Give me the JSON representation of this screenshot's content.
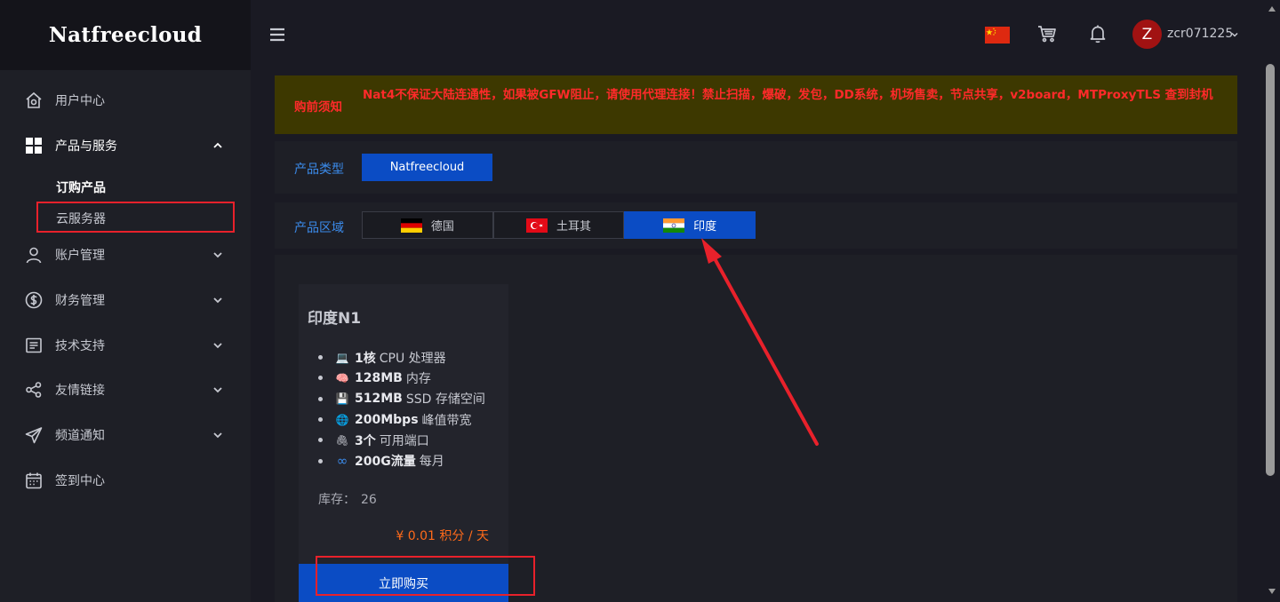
{
  "brand": {
    "name": "Natfreecloud"
  },
  "sidebar": {
    "items": [
      {
        "label": "用户中心",
        "icon": "home-icon"
      },
      {
        "label": "产品与服务",
        "icon": "grid-icon"
      },
      {
        "label": "账户管理",
        "icon": "user-icon"
      },
      {
        "label": "财务管理",
        "icon": "dollar-icon"
      },
      {
        "label": "技术支持",
        "icon": "document-icon"
      },
      {
        "label": "友情链接",
        "icon": "share-icon"
      },
      {
        "label": "频道通知",
        "icon": "send-icon"
      },
      {
        "label": "签到中心",
        "icon": "calendar-icon"
      }
    ],
    "sub_items": [
      {
        "label": "订购产品"
      },
      {
        "label": "云服务器"
      }
    ]
  },
  "header": {
    "username": "zcr071225",
    "avatar_letter": "Z"
  },
  "notice": {
    "label": "购前须知",
    "text": "Nat4不保证大陆连通性，如果被GFW阻止，请使用代理连接！禁止扫描，爆破，发包，DD系统，机场售卖，节点共享，v2board，MTProxyTLS 查到封机"
  },
  "product_type": {
    "label": "产品类型",
    "value": "Natfreecloud"
  },
  "product_region": {
    "label": "产品区域",
    "tabs": [
      {
        "label": "德国",
        "flag": "germany"
      },
      {
        "label": "土耳其",
        "flag": "turkey"
      },
      {
        "label": "印度",
        "flag": "india",
        "selected": true
      }
    ]
  },
  "product": {
    "name": "印度N1",
    "specs": [
      {
        "emoji": "💻",
        "bold": "1核",
        "text": "CPU 处理器"
      },
      {
        "emoji": "🧠",
        "bold": "128MB",
        "text": "内存"
      },
      {
        "emoji": "💾",
        "bold": "512MB",
        "text": "SSD 存储空间"
      },
      {
        "emoji": "🌐",
        "bold": "200Mbps",
        "text": "峰值带宽"
      },
      {
        "emoji": "🖇",
        "bold": "3个",
        "text": "可用端口"
      },
      {
        "emoji": "∞",
        "bold": "200G流量",
        "text": "每月"
      }
    ],
    "stock_label": "库存：",
    "stock_value": "26",
    "price": "¥ 0.01 积分 / 天",
    "buy_label": "立即购买"
  },
  "colors": {
    "accent_blue": "#0b4cc4",
    "notice_red": "#ff2a2a",
    "price_orange": "#ff6a1a",
    "annotation_red": "#e8212b"
  }
}
